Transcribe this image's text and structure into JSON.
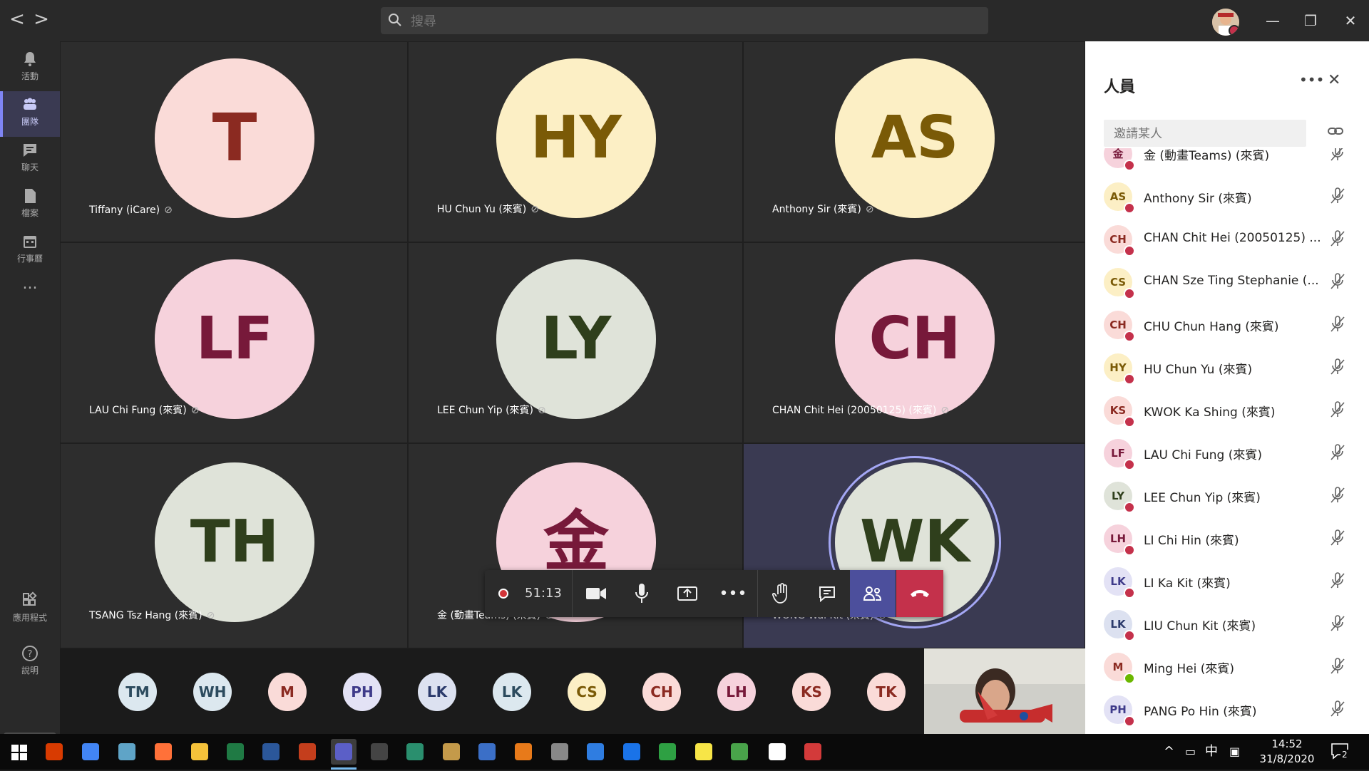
{
  "app": {
    "search_placeholder": "搜尋",
    "nav_back": "<",
    "nav_forward": ">"
  },
  "rail": [
    {
      "id": "activity",
      "label": "活動",
      "icon": "bell-icon"
    },
    {
      "id": "teams",
      "label": "團隊",
      "icon": "teams-icon",
      "active": true
    },
    {
      "id": "chat",
      "label": "聊天",
      "icon": "chat-icon"
    },
    {
      "id": "files",
      "label": "檔案",
      "icon": "file-icon"
    },
    {
      "id": "calendar",
      "label": "行事曆",
      "icon": "calendar-icon"
    },
    {
      "id": "more",
      "label": "...",
      "icon": "more-icon"
    },
    {
      "id": "apps",
      "label": "應用程式",
      "icon": "apps-icon"
    },
    {
      "id": "help",
      "label": "說明",
      "icon": "help-icon"
    }
  ],
  "grid": [
    {
      "initials": "T",
      "name": "Tiffany (iCare)",
      "bg": "#fadbd8",
      "fg": "#8b2a21"
    },
    {
      "initials": "HY",
      "name": "HU Chun Yu (來賓)",
      "bg": "#fcefc5",
      "fg": "#7a5a07"
    },
    {
      "initials": "AS",
      "name": "Anthony Sir (來賓)",
      "bg": "#fcefc5",
      "fg": "#7a5a07"
    },
    {
      "initials": "LF",
      "name": "LAU Chi Fung (來賓)",
      "bg": "#f6d2dc",
      "fg": "#77193a"
    },
    {
      "initials": "LY",
      "name": "LEE Chun Yip (來賓)",
      "bg": "#dfe3d9",
      "fg": "#2f3f1c"
    },
    {
      "initials": "CH",
      "name": "CHAN Chit Hei (20050125) (來賓)",
      "bg": "#f6d2dc",
      "fg": "#77193a"
    },
    {
      "initials": "TH",
      "name": "TSANG Tsz Hang (來賓)",
      "bg": "#dfe3d9",
      "fg": "#2f3f1c"
    },
    {
      "initials": "金",
      "name": "金 (動畫Teams) (來賓)",
      "bg": "#f6d2dc",
      "fg": "#77193a"
    },
    {
      "initials": "WK",
      "name": "WONG Wai Kit (來賓)",
      "bg": "#dfe3d9",
      "fg": "#2f3f1c",
      "speaking": true
    }
  ],
  "controls": {
    "timer": "51:13"
  },
  "overflow": [
    {
      "initials": "TM",
      "bg": "#dce8ef",
      "fg": "#2c4b5e"
    },
    {
      "initials": "WH",
      "bg": "#dce8ef",
      "fg": "#2c4b5e"
    },
    {
      "initials": "M",
      "bg": "#fadbd8",
      "fg": "#8b2a21"
    },
    {
      "initials": "PH",
      "bg": "#e3e2f5",
      "fg": "#3f3b8a"
    },
    {
      "initials": "LK",
      "bg": "#dce1f0",
      "fg": "#2b3a6b"
    },
    {
      "initials": "LK",
      "bg": "#dce8ef",
      "fg": "#2c4b5e"
    },
    {
      "initials": "CS",
      "bg": "#fcefc5",
      "fg": "#7a5a07"
    },
    {
      "initials": "CH",
      "bg": "#fadbd8",
      "fg": "#8b2a21"
    },
    {
      "initials": "LH",
      "bg": "#f6d2dc",
      "fg": "#77193a"
    },
    {
      "initials": "KS",
      "bg": "#fadbd8",
      "fg": "#8b2a21"
    },
    {
      "initials": "TK",
      "bg": "#fadbd8",
      "fg": "#8b2a21"
    }
  ],
  "people_panel": {
    "title": "人員",
    "more": "•••",
    "close": "✕",
    "invite_placeholder": "邀請某人",
    "participants": [
      {
        "initials": "金",
        "name": "金 (動畫Teams) (來賓)",
        "bg": "#f6d2dc",
        "fg": "#77193a",
        "status": "busy"
      },
      {
        "initials": "AS",
        "name": "Anthony Sir (來賓)",
        "bg": "#fcefc5",
        "fg": "#7a5a07",
        "status": "busy"
      },
      {
        "initials": "CH",
        "name": "CHAN Chit Hei (20050125) ...",
        "bg": "#fadbd8",
        "fg": "#8b2a21",
        "status": "busy"
      },
      {
        "initials": "CS",
        "name": "CHAN Sze Ting Stephanie (...",
        "bg": "#fcefc5",
        "fg": "#7a5a07",
        "status": "busy"
      },
      {
        "initials": "CH",
        "name": "CHU Chun Hang (來賓)",
        "bg": "#fadbd8",
        "fg": "#8b2a21",
        "status": "busy"
      },
      {
        "initials": "HY",
        "name": "HU Chun Yu (來賓)",
        "bg": "#fcefc5",
        "fg": "#7a5a07",
        "status": "busy"
      },
      {
        "initials": "KS",
        "name": "KWOK Ka Shing (來賓)",
        "bg": "#fadbd8",
        "fg": "#8b2a21",
        "status": "busy"
      },
      {
        "initials": "LF",
        "name": "LAU Chi Fung (來賓)",
        "bg": "#f6d2dc",
        "fg": "#77193a",
        "status": "busy"
      },
      {
        "initials": "LY",
        "name": "LEE Chun Yip (來賓)",
        "bg": "#dfe3d9",
        "fg": "#2f3f1c",
        "status": "busy"
      },
      {
        "initials": "LH",
        "name": "LI Chi Hin (來賓)",
        "bg": "#f6d2dc",
        "fg": "#77193a",
        "status": "busy"
      },
      {
        "initials": "LK",
        "name": "LI Ka Kit (來賓)",
        "bg": "#e3e2f5",
        "fg": "#3f3b8a",
        "status": "busy"
      },
      {
        "initials": "LK",
        "name": "LIU Chun Kit (來賓)",
        "bg": "#dce1f0",
        "fg": "#2b3a6b",
        "status": "busy"
      },
      {
        "initials": "M",
        "name": "Ming Hei (來賓)",
        "bg": "#fadbd8",
        "fg": "#8b2a21",
        "status": "available"
      },
      {
        "initials": "PH",
        "name": "PANG Po Hin (來賓)",
        "bg": "#e3e2f5",
        "fg": "#3f3b8a",
        "status": "busy"
      }
    ]
  },
  "taskbar": {
    "ime": "中",
    "time": "14:52",
    "date": "31/8/2020",
    "notifications": "2"
  }
}
